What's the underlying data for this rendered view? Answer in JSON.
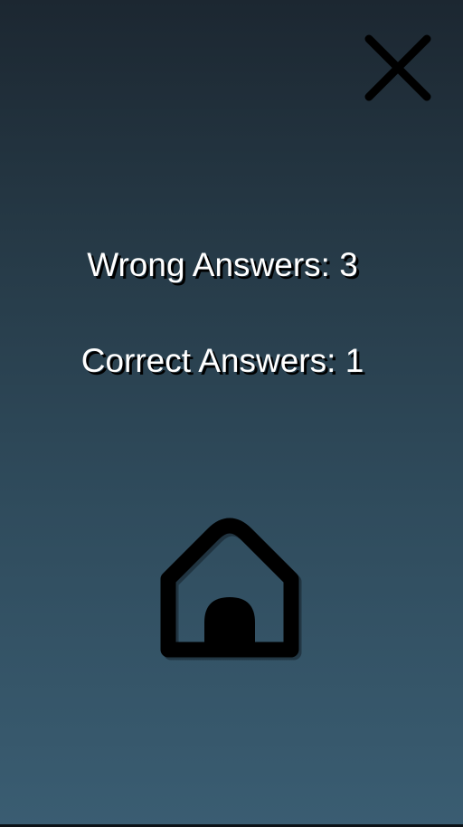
{
  "close_button": {
    "icon": "close-icon"
  },
  "results": {
    "wrong_answers": "Wrong Answers: 3",
    "correct_answers": "Correct Answers: 1"
  },
  "home_button": {
    "icon": "home-icon"
  },
  "colors": {
    "text": "#ffffff",
    "text_shadow": "#000000",
    "icon": "#000000",
    "background_top": "#1c2731",
    "background_bottom": "#3a5d72"
  }
}
